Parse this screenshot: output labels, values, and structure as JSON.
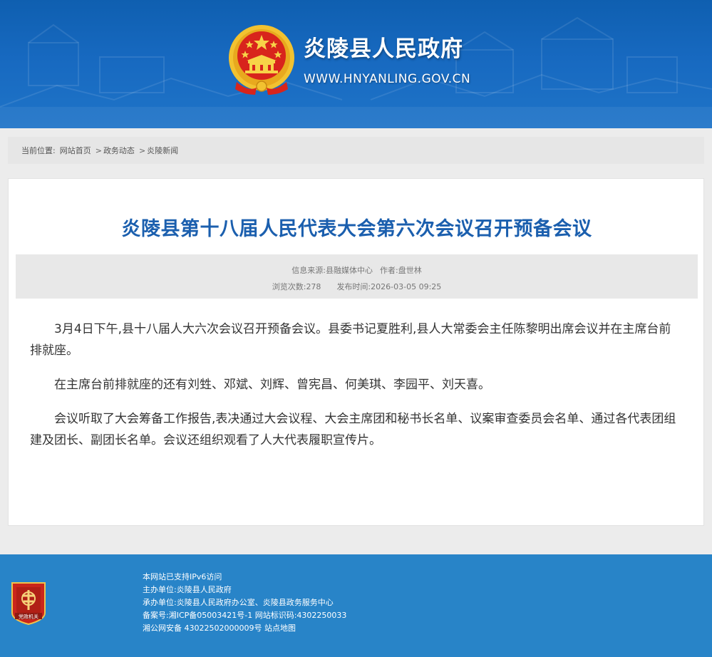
{
  "header": {
    "site_name": "炎陵县人民政府",
    "site_url": "WWW.HNYANLING.GOV.CN",
    "emblem_icon": "national-emblem-icon",
    "colors": {
      "header_blue": "#1769c0",
      "emblem_red": "#d8241c",
      "emblem_gold": "#f2c230"
    }
  },
  "breadcrumb": {
    "label": "当前位置:",
    "items": [
      "网站首页",
      "政务动态",
      "炎陵新闻"
    ],
    "separator": ">"
  },
  "article": {
    "title": "炎陵县第十八届人民代表大会第六次会议召开预备会议",
    "source_label": "信息来源:",
    "source": "县融媒体中心",
    "author_label": "作者:",
    "author": "盘世林",
    "views_label": "浏览次数:",
    "views": "278",
    "date_label": "发布时间:",
    "date": "2026-03-05 09:25",
    "paragraphs": [
      "3月4日下午,县十八届人大六次会议召开预备会议。县委书记夏胜利,县人大常委会主任陈黎明出席会议并在主席台前排就座。",
      "在主席台前排就座的还有刘甡、邓斌、刘辉、曾宪昌、何美琪、李园平、刘天喜。",
      "会议听取了大会筹备工作报告,表决通过大会议程、大会主席团和秘书长名单、议案审查委员会名单、通过各代表团组建及团长、副团长名单。会议还组织观看了人大代表履职宣传片。"
    ],
    "colors": {
      "title": "#1b5fae"
    }
  },
  "footer": {
    "badge_icon": "party-government-badge-icon",
    "badge_text": "党政机关",
    "lines": [
      "本网站已支持IPv6访问",
      "主办单位:炎陵县人民政府",
      "承办单位:炎陵县人民政府办公室、炎陵县政务服务中心",
      "备案号:湘ICP备05003421号-1 网站标识码:4302250033",
      "湘公网安备 43022502000009号 站点地图"
    ],
    "colors": {
      "footer_blue": "#2884c8"
    }
  }
}
